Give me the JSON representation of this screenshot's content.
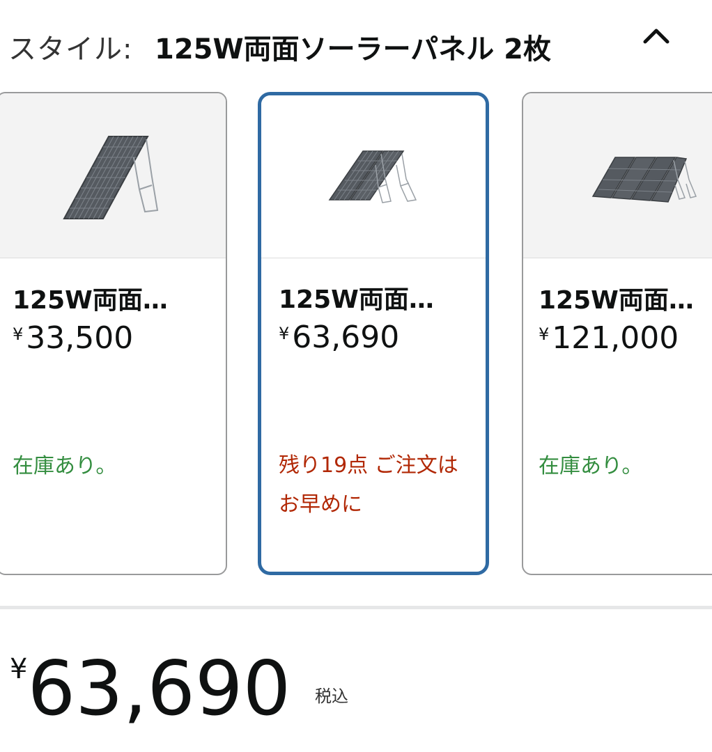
{
  "header": {
    "label": "スタイル:",
    "value": "125W両面ソーラーパネル 2枚",
    "toggle_icon": "chevron-up-icon"
  },
  "options": [
    {
      "title": "125W両面…",
      "currency": "¥",
      "price": "33,500",
      "availability": "在庫あり。",
      "availability_color": "#338d3f",
      "selected": false
    },
    {
      "title": "125W両面…",
      "currency": "¥",
      "price": "63,690",
      "availability": "残り19点 ご注文はお早めに",
      "availability_color": "#b12704",
      "selected": true
    },
    {
      "title": "125W両面…",
      "currency": "¥",
      "price": "121,000",
      "availability": "在庫あり。",
      "availability_color": "#338d3f",
      "selected": false
    }
  ],
  "summary": {
    "currency": "¥",
    "price": "63,690",
    "tax_label": "税込"
  },
  "colors": {
    "selected_border": "#2f6aa3",
    "in_stock": "#338d3f",
    "low_stock": "#b12704"
  }
}
